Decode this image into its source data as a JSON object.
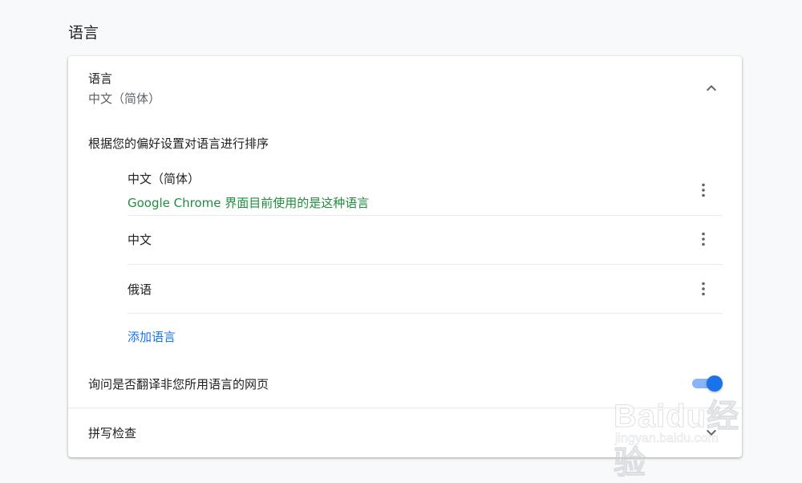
{
  "section_title": "语言",
  "language": {
    "title": "语言",
    "current": "中文（简体）",
    "order_label": "根据您的偏好设置对语言进行排序",
    "items": [
      {
        "name": "中文（简体）",
        "note": "Google Chrome 界面目前使用的是这种语言"
      },
      {
        "name": "中文"
      },
      {
        "name": "俄语"
      }
    ],
    "add_label": "添加语言"
  },
  "translate": {
    "label": "询问是否翻译非您所用语言的网页",
    "enabled": true
  },
  "spellcheck": {
    "label": "拼写检查"
  },
  "watermark": {
    "brand": "Baidu经验",
    "url": "jingyan.baidu.com"
  },
  "colors": {
    "accent": "#1a73e8",
    "note_green": "#1e8e3e",
    "toggle_track": "#8ab4f8"
  },
  "icons": {
    "collapse": "chevron-up-icon",
    "more": "more-vert-icon",
    "expand": "chevron-down-icon"
  }
}
